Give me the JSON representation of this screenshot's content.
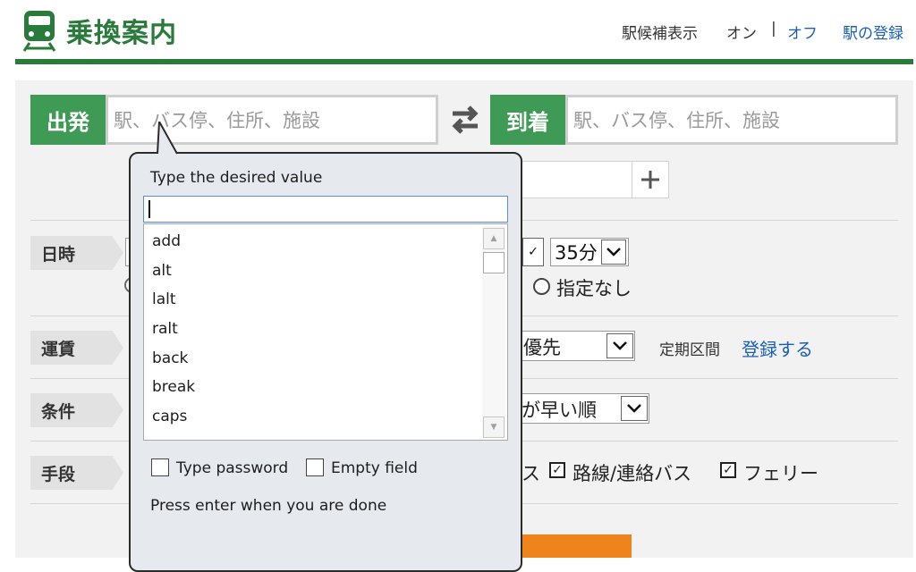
{
  "header": {
    "title": "乗換案内",
    "station_candidates_label": "駅候補表示",
    "on_label": "オン",
    "separator": "|",
    "off_label": "オフ",
    "register_station_label": "駅の登録"
  },
  "search": {
    "departure_tag": "出発",
    "departure_placeholder": "駅、バス停、住所、施設",
    "arrival_tag": "到着",
    "arrival_placeholder": "駅、バス停、住所、施設",
    "swap_icon": "swap-arrows-icon",
    "add_via_icon": "plus-icon"
  },
  "datetime": {
    "label": "日時",
    "minute_value": "35分",
    "no_spec_label": "指定なし"
  },
  "fare": {
    "label": "運賃",
    "priority_value": "優先",
    "commuter_label": "定期区間",
    "register_link": "登録する"
  },
  "conditions": {
    "label": "条件",
    "sort_value": "が早い順"
  },
  "means": {
    "label": "手段",
    "partial_item": "ス",
    "route_bus_label": "路線/連絡バス",
    "ferry_label": "フェリー"
  },
  "popup": {
    "prompt": "Type the desired value",
    "input_value": "",
    "options": [
      "add",
      "alt",
      "lalt",
      "ralt",
      "back",
      "break",
      "caps"
    ],
    "type_password_label": "Type password",
    "empty_field_label": "Empty field",
    "hint": "Press enter when you are done"
  },
  "colors": {
    "brand_green": "#2a7a3b",
    "tag_green": "#3f9a55",
    "link_blue": "#1a5fb4",
    "search_orange": "#f0841c"
  }
}
